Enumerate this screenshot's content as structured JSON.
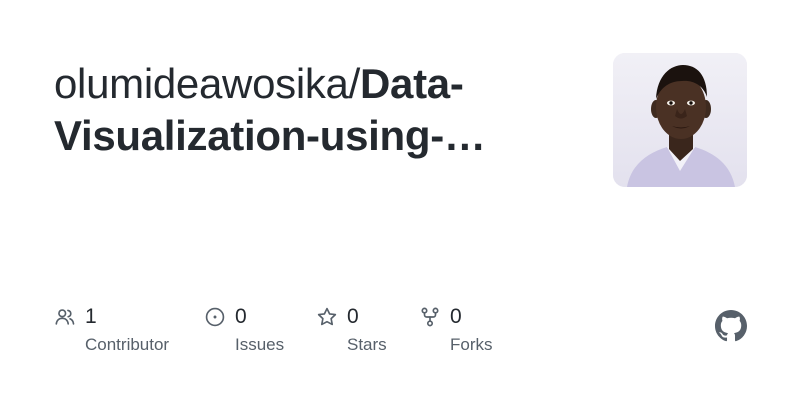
{
  "repo": {
    "owner": "olumideawosika/",
    "name": "Data-Visualization-using-…"
  },
  "avatar": {
    "alt": "owner avatar"
  },
  "stats": [
    {
      "icon": "people-icon",
      "count": "1",
      "label": "Contributor"
    },
    {
      "icon": "issue-opened-icon",
      "count": "0",
      "label": "Issues"
    },
    {
      "icon": "star-icon",
      "count": "0",
      "label": "Stars"
    },
    {
      "icon": "repo-forked-icon",
      "count": "0",
      "label": "Forks"
    }
  ],
  "brand": {
    "icon": "github-mark-icon"
  },
  "colors": {
    "text_primary": "#24292f",
    "text_muted": "#57606a",
    "background": "#ffffff"
  }
}
